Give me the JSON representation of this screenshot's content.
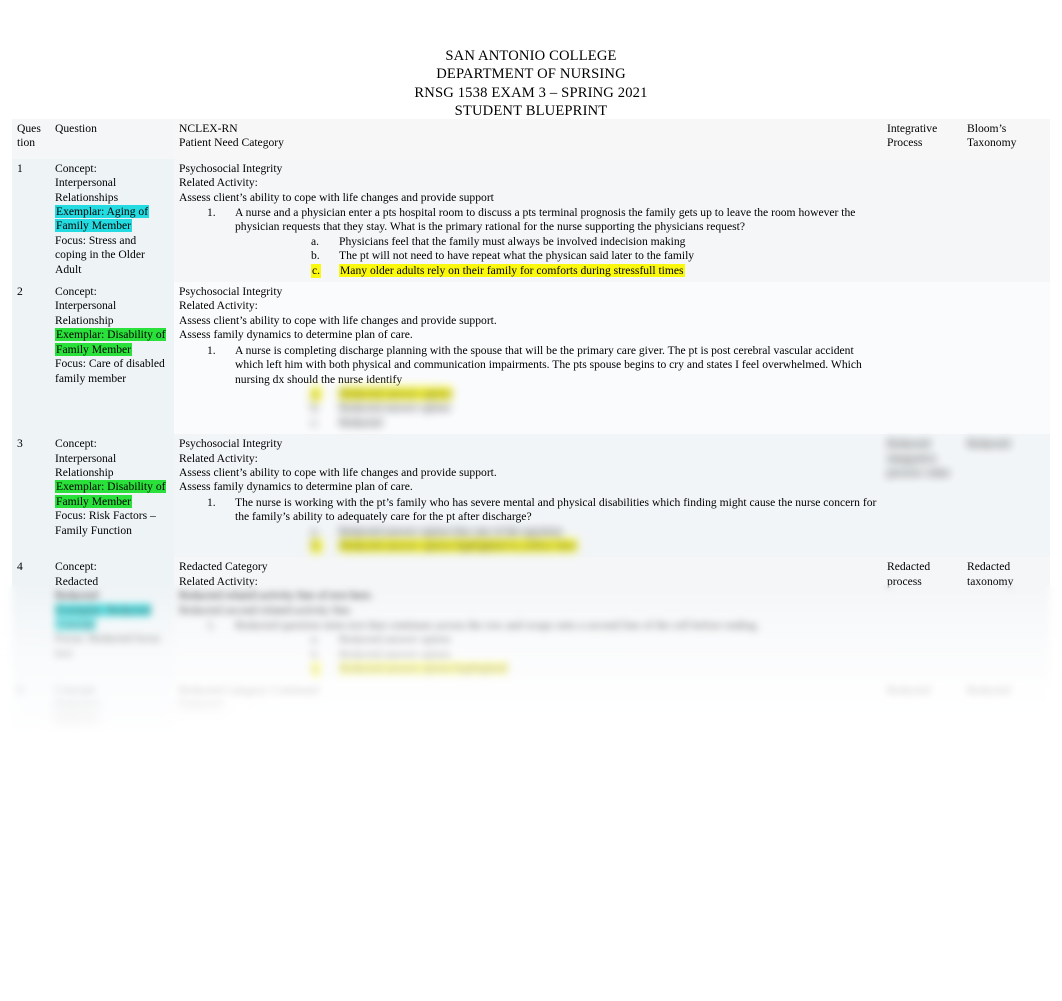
{
  "document": {
    "title_lines": [
      "SAN ANTONIO COLLEGE",
      "DEPARTMENT OF NURSING",
      "RNSG 1538 EXAM 3 – SPRING 2021",
      "STUDENT BLUEPRINT"
    ]
  },
  "colors": {
    "highlight_yellow": "#fbf80f",
    "highlight_cyan": "#23dbe0",
    "highlight_green": "#2ae03a",
    "text": "#000000",
    "page_background": "#ffffff"
  },
  "table": {
    "headers": {
      "question_number": [
        "Ques",
        "tion"
      ],
      "question": "Question",
      "nclex": [
        "NCLEX-RN",
        "Patient Need Category"
      ],
      "integrative_process": [
        "Integrative",
        "Process"
      ],
      "blooms_taxonomy": [
        "Bloom’s",
        "Taxonomy"
      ]
    },
    "rows": [
      {
        "number": "1",
        "question_col": {
          "concept_label": "Concept:",
          "concept_lines": [
            "Interpersonal",
            "Relationships"
          ],
          "exemplar": "Exemplar: Aging of Family Member",
          "exemplar_highlight": "cyan",
          "focus": "Focus: Stress and coping in the Older Adult"
        },
        "nclex_col": {
          "category": "Psychosocial Integrity",
          "related_activity_label": "Related Activity:",
          "activities": [
            "Assess client’s ability to cope with life changes and provide support"
          ],
          "items": [
            {
              "marker": "1.",
              "text": "A nurse and a physician enter a pts hospital room to discuss a pts terminal prognosis the family gets up to leave the room however the physician requests that they stay. What is the primary rational for the nurse supporting the physicians request?",
              "answers": [
                {
                  "marker": "a.",
                  "text": "Physicians feel that the family must always be involved indecision making",
                  "highlight": "none"
                },
                {
                  "marker": "b.",
                  "text": "The pt will not need to have repeat what the physican said later to the family",
                  "highlight": "none"
                },
                {
                  "marker": "c.",
                  "text": "Many older adults rely on their family for comforts during stressfull times",
                  "highlight": "yellow"
                }
              ]
            }
          ]
        },
        "integrative_process": "",
        "blooms_taxonomy": ""
      },
      {
        "number": "2",
        "question_col": {
          "concept_label": "Concept:",
          "concept_lines": [
            "Interpersonal",
            "Relationship"
          ],
          "exemplar": "Exemplar: Disability of Family Member",
          "exemplar_highlight": "green",
          "focus": "Focus: Care of disabled family member"
        },
        "nclex_col": {
          "category": "Psychosocial Integrity",
          "related_activity_label": "Related Activity:",
          "activities": [
            "Assess client’s ability to cope with life changes and provide support.",
            "Assess family dynamics to determine plan of care."
          ],
          "items": [
            {
              "marker": "1.",
              "text": "A nurse is completing discharge planning with the spouse that will be the primary care giver. The pt is post cerebral vascular accident which left him with both physical and communication impairments. The pts spouse begins to cry and states I feel overwhelmed. Which nursing dx should the nurse identify",
              "answers": [],
              "redacted_answers": [
                {
                  "marker": "a.",
                  "text": "Redacted answer option",
                  "highlight": "yellow"
                },
                {
                  "marker": "b.",
                  "text": "Redacted answer option",
                  "highlight": "none"
                },
                {
                  "marker": "c.",
                  "text": "Redacted",
                  "highlight": "none"
                }
              ]
            }
          ]
        },
        "integrative_process": "",
        "blooms_taxonomy": ""
      },
      {
        "number": "3",
        "question_col": {
          "concept_label": "Concept:",
          "concept_lines": [
            "Interpersonal",
            "Relationship"
          ],
          "exemplar": "Exemplar: Disability of Family Member",
          "exemplar_highlight": "green",
          "focus": "Focus: Risk Factors – Family Function"
        },
        "nclex_col": {
          "category": "Psychosocial Integrity",
          "related_activity_label": "Related Activity:",
          "activities": [
            "Assess client’s ability to cope with life changes and provide support.",
            "Assess family dynamics to determine plan of care."
          ],
          "items": [
            {
              "marker": "1.",
              "text": "The nurse is working with the pt’s family who has severe mental and physical disabilities which finding might cause the nurse concern for the family’s ability to adequately care for the pt after discharge?",
              "answers": [],
              "redacted_answers": [
                {
                  "marker": "a.",
                  "text": "Redacted answer option line one of the question",
                  "highlight": "none"
                },
                {
                  "marker": "b.",
                  "text": "Redacted answer option highlighted in yellow here",
                  "highlight": "yellow"
                }
              ]
            }
          ]
        },
        "integrative_process_redacted": "Redacted integrative process value",
        "blooms_taxonomy_redacted": "Redacted"
      },
      {
        "number": "4",
        "question_col": {
          "concept_label": "Concept:",
          "concept_lines": [
            "Redacted",
            "Redacted"
          ],
          "exemplar": "Exemplar: Redacted Concept",
          "exemplar_highlight": "cyan",
          "focus": "Focus: Redacted focus text"
        },
        "nclex_col": {
          "category": "Redacted Category",
          "related_activity_label": "Related Activity:",
          "activities": [
            "Redacted related activity line of text here.",
            "Redacted second related activity line."
          ],
          "items": [
            {
              "marker": "1.",
              "text": "Redacted question stem text that continues across the row and wraps onto a second line of the cell before ending.",
              "answers": [],
              "redacted_answers": [
                {
                  "marker": "a.",
                  "text": "Redacted answer option",
                  "highlight": "none"
                },
                {
                  "marker": "b.",
                  "text": "Redacted answer option",
                  "highlight": "none"
                },
                {
                  "marker": "c.",
                  "text": "Redacted answer option highlighted",
                  "highlight": "yellow"
                }
              ]
            }
          ]
        },
        "integrative_process_redacted": "Redacted process",
        "blooms_taxonomy_redacted": "Redacted taxonomy"
      },
      {
        "number": "5",
        "question_col": {
          "concept_label": "Concept:",
          "concept_lines": [
            "Redacted",
            "Redacted"
          ],
          "exemplar": "",
          "exemplar_highlight": "none",
          "focus": ""
        },
        "nclex_col": {
          "category": "Redacted Category Continued",
          "related_activity_label": "Redacted",
          "activities": [],
          "items": []
        },
        "integrative_process_redacted": "Redacted",
        "blooms_taxonomy_redacted": "Redacted"
      }
    ]
  }
}
